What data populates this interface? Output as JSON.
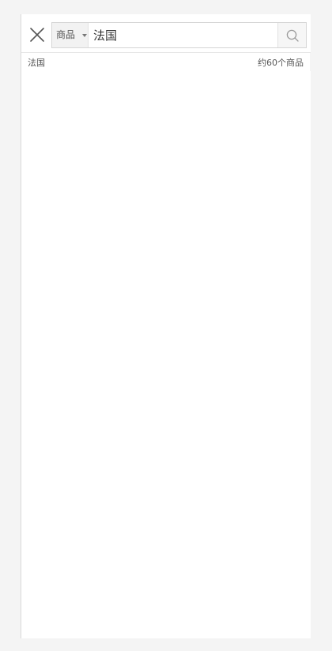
{
  "search": {
    "category_label": "商品",
    "query_value": "法国",
    "placeholder": "",
    "close_icon": "close-icon",
    "search_icon": "search-icon"
  },
  "results": {
    "query": "法国",
    "count_text": "约60个商品"
  },
  "colors": {
    "background": "#f4f4f4",
    "panel": "#ffffff",
    "border": "#d6d6d6",
    "text": "#333333"
  }
}
